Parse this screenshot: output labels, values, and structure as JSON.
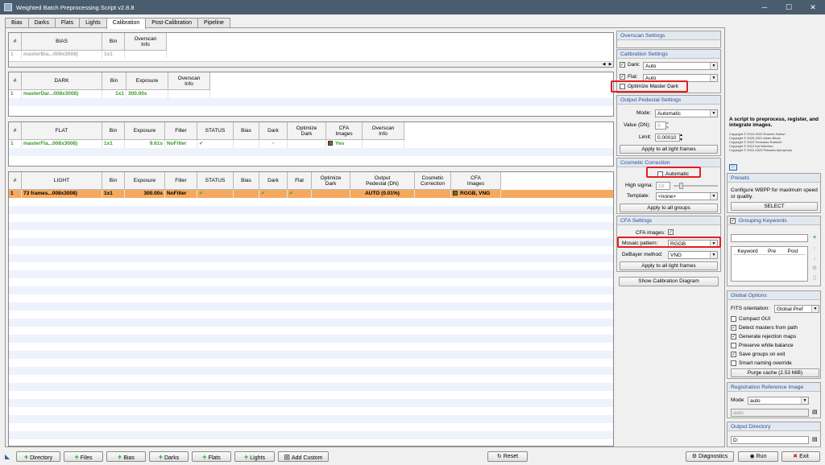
{
  "window": {
    "title": "Weighted Batch Preprocessing Script v2.8.8",
    "minimize": "─",
    "maximize": "☐",
    "close": "✕"
  },
  "tabs": [
    "Bias",
    "Darks",
    "Flats",
    "Lights",
    "Calibration",
    "Post-Calibration",
    "Pipeline"
  ],
  "bias_table": {
    "headers": [
      "#",
      "BIAS",
      "Bin",
      "Overscan\nInfo"
    ],
    "rows": [
      [
        "1",
        "masterBia...008x3008)",
        "1x1",
        ""
      ]
    ]
  },
  "dark_table": {
    "headers": [
      "#",
      "DARK",
      "Bin",
      "Exposure",
      "Overscan\nInfo"
    ],
    "rows": [
      [
        "1",
        "masterDar...008x3008)",
        "1x1",
        "300.00s",
        ""
      ]
    ]
  },
  "flat_table": {
    "headers": [
      "#",
      "FLAT",
      "Bin",
      "Exposure",
      "Filter",
      "STATUS",
      "Bias",
      "Dark",
      "Optimize\nDark",
      "CFA\nImages",
      "Overscan\nInfo"
    ],
    "rows": [
      [
        "1",
        "masterFla...008x3008)",
        "1x1",
        "9.61s",
        "NoFilter",
        "✔",
        "",
        "×",
        "",
        "Yes",
        ""
      ]
    ]
  },
  "light_table": {
    "headers": [
      "#",
      "LIGHT",
      "Bin",
      "Exposure",
      "Filter",
      "STATUS",
      "Bias",
      "Dark",
      "Flat",
      "Optimize\nDark",
      "Output\nPedestal (DN)",
      "Cosmetic\nCorrection",
      "CFA\nImages"
    ],
    "rows": [
      [
        "1",
        "73 frames...008x3008)",
        "1x1",
        "300.00s",
        "NoFilter",
        "✔",
        "×",
        "✔",
        "✔",
        "×",
        "AUTO (0.01%)",
        "×",
        "RGGB, VNG"
      ]
    ]
  },
  "overscan": {
    "title": "Overscan Settings"
  },
  "calibration": {
    "title": "Calibration Settings",
    "dark_label": "Dark:",
    "dark_value": "Auto",
    "flat_label": "Flat:",
    "flat_value": "Auto",
    "optimize_label": "Optimize Master Dark"
  },
  "pedestal": {
    "title": "Output Pedestal Settings",
    "mode_label": "Mode:",
    "mode_value": "Automatic",
    "value_label": "Value (DN):",
    "value_value": "0",
    "limit_label": "Limit:",
    "limit_value": "0.00010",
    "apply": "Apply to all light frames"
  },
  "cosmetic": {
    "title": "Cosmetic Correction",
    "automatic_label": "Automatic",
    "high_sigma_label": "High sigma:",
    "high_sigma_value": "10",
    "template_label": "Template:",
    "template_value": "<none>",
    "apply": "Apply to all groups"
  },
  "cfa": {
    "title": "CFA Settings",
    "cfa_images_label": "CFA images:",
    "mosaic_label": "Mosaic pattern:",
    "mosaic_value": "RGGB",
    "debayer_label": "DeBayer method:",
    "debayer_value": "VNG",
    "apply": "Apply to all light frames"
  },
  "show_calibration_diagram": "Show Calibration Diagram",
  "about": {
    "text": "A script to preprocess, register, and integrate images.",
    "copyright": [
      "Copyright © 2019-2020 Roberto Sartori",
      "Copyright © 2020-2021 Adam Block",
      "Copyright © 2019 Tommaso Rubechi",
      "Copyright © 2012 Kai Wiechen",
      "Copyright © 2012-2020 Pleiades Astrophoto"
    ]
  },
  "presets": {
    "title": "Presets",
    "text": "Configure WBPP for maximum speed or quality.",
    "select": "SELECT"
  },
  "grouping": {
    "title": "Grouping Keywords",
    "headers": [
      "Keyword",
      "Pre",
      "Post"
    ]
  },
  "global": {
    "title": "Global Options",
    "fits_label": "FITS orientation:",
    "fits_value": "Global Pref",
    "options": [
      {
        "label": "Compact GUI",
        "checked": false
      },
      {
        "label": "Detect masters from path",
        "checked": true
      },
      {
        "label": "Generate rejection maps",
        "checked": true
      },
      {
        "label": "Preserve white balance",
        "checked": false
      },
      {
        "label": "Save groups on exit",
        "checked": true
      },
      {
        "label": "Smart naming override",
        "checked": false
      }
    ],
    "purge": "Purge cache (2.53 MiB)"
  },
  "registration": {
    "title": "Registration Reference Image",
    "mode_label": "Mode",
    "mode_value": "auto",
    "value": "auto"
  },
  "output": {
    "title": "Output Directory",
    "value": "D:"
  },
  "bottom": {
    "directory": "Directory",
    "files": "Files",
    "bias": "Bias",
    "darks": "Darks",
    "flats": "Flats",
    "lights": "Lights",
    "add_custom": "Add Custom",
    "reset": "Reset",
    "diagnostics": "Diagnostics",
    "run": "Run",
    "exit": "Exit"
  }
}
